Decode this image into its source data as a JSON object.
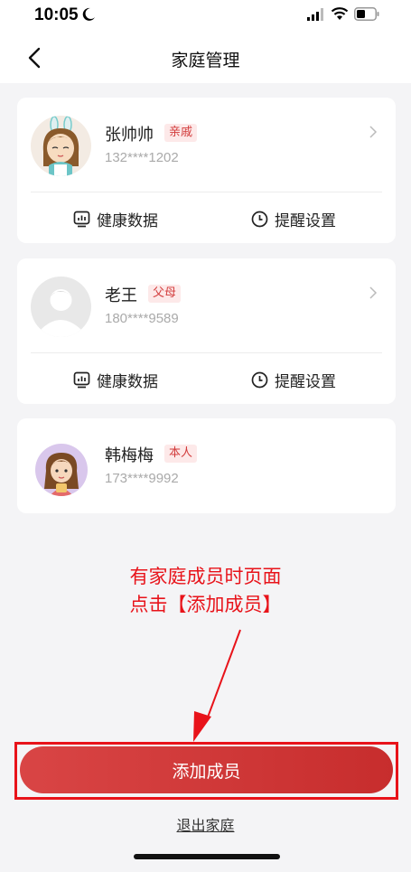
{
  "status_bar": {
    "time": "10:05"
  },
  "header": {
    "title": "家庭管理"
  },
  "members": [
    {
      "name": "张帅帅",
      "relation": "亲戚",
      "phone": "132****1202",
      "actions": [
        "健康数据",
        "提醒设置"
      ]
    },
    {
      "name": "老王",
      "relation": "父母",
      "phone": "180****9589",
      "actions": [
        "健康数据",
        "提醒设置"
      ]
    },
    {
      "name": "韩梅梅",
      "relation": "本人",
      "phone": "173****9992"
    }
  ],
  "annotation": {
    "line1": "有家庭成员时页面",
    "line2": "点击【添加成员】"
  },
  "footer": {
    "add_button": "添加成员",
    "exit_link": "退出家庭"
  },
  "colors": {
    "accent": "#d23b3b",
    "annotation": "#e8131a",
    "background": "#f4f4f6"
  }
}
